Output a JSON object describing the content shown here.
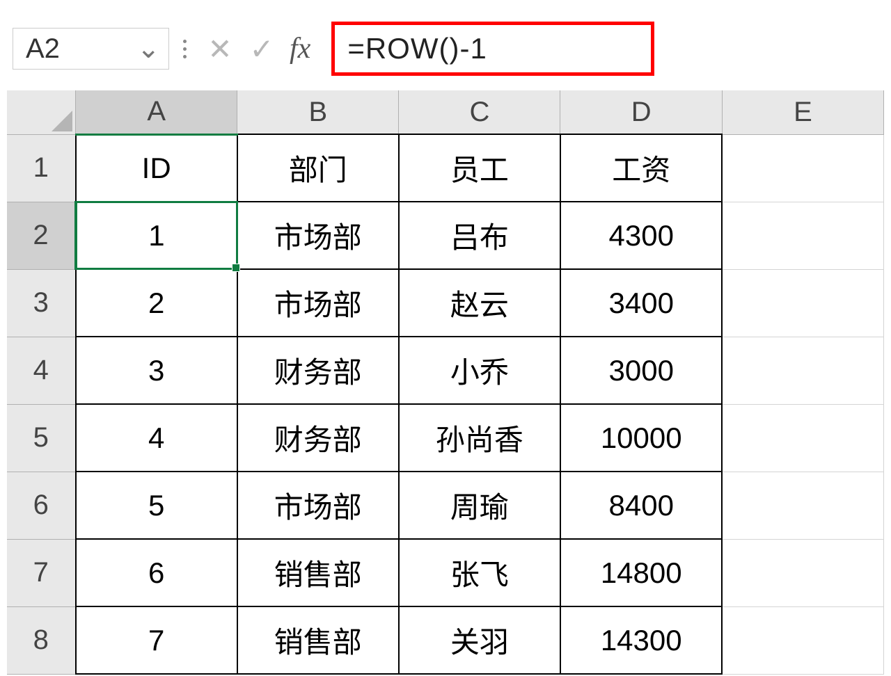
{
  "formula_bar": {
    "cell_reference": "A2",
    "formula": "=ROW()-1"
  },
  "columns": [
    "A",
    "B",
    "C",
    "D",
    "E"
  ],
  "rows": [
    "1",
    "2",
    "3",
    "4",
    "5",
    "6",
    "7",
    "8"
  ],
  "active_cell": {
    "row": 2,
    "col": "A"
  },
  "headers": {
    "col_a": "ID",
    "col_b": "部门",
    "col_c": "员工",
    "col_d": "工资"
  },
  "data": [
    {
      "id": "1",
      "dept": "市场部",
      "emp": "吕布",
      "salary": "4300"
    },
    {
      "id": "2",
      "dept": "市场部",
      "emp": "赵云",
      "salary": "3400"
    },
    {
      "id": "3",
      "dept": "财务部",
      "emp": "小乔",
      "salary": "3000"
    },
    {
      "id": "4",
      "dept": "财务部",
      "emp": "孙尚香",
      "salary": "10000"
    },
    {
      "id": "5",
      "dept": "市场部",
      "emp": "周瑜",
      "salary": "8400"
    },
    {
      "id": "6",
      "dept": "销售部",
      "emp": "张飞",
      "salary": "14800"
    },
    {
      "id": "7",
      "dept": "销售部",
      "emp": "关羽",
      "salary": "14300"
    }
  ],
  "icons": {
    "cancel": "✕",
    "enter": "✓",
    "fx": "fx",
    "dropdown": "⌄"
  }
}
